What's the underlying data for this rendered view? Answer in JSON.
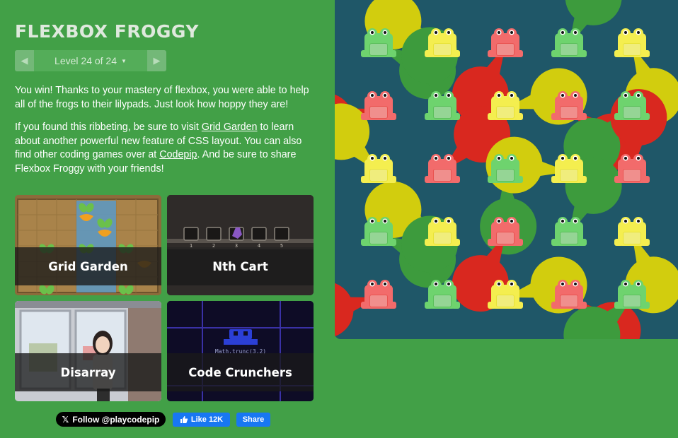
{
  "sidebar": {
    "title": "FLEXBOX FROGGY",
    "level": {
      "prev_icon": "triangle-left-icon",
      "label": "Level 24 of 24",
      "dropdown_icon": "caret-down-icon",
      "next_icon": "triangle-right-icon"
    },
    "intro": {
      "text": "You win! Thanks to your mastery of flexbox, you were able to help all of the frogs to their lilypads. Just look how hoppy they are!"
    },
    "promo": {
      "part1": "If you found this ribbeting, be sure to visit ",
      "link1": "Grid Garden",
      "part2": " to learn about another powerful new feature of CSS layout. You can also find other coding games over at ",
      "link2": "Codepip",
      "part3": ". And be sure to share Flexbox Froggy with your friends!"
    },
    "games": [
      {
        "name": "Grid Garden"
      },
      {
        "name": "Nth Cart",
        "cart_numbers": [
          "1",
          "2",
          "3",
          "4",
          "5"
        ]
      },
      {
        "name": "Disarray"
      },
      {
        "name": "Code Crunchers",
        "snippet": "Math.trunc(3.2)"
      }
    ],
    "social": {
      "follow_icon": "x-logo-icon",
      "follow_label": "Follow @playcodepip",
      "like_icon": "thumbs-up-icon",
      "like_label": "Like 12K",
      "share_label": "Share"
    }
  },
  "board": {
    "colors": {
      "green_pad": "#3d9b3d",
      "green_frog": "#6ed36e",
      "yellow_pad": "#d2cd0e",
      "yellow_frog": "#f4ee4f",
      "red_pad": "#d9281f",
      "red_frog": "#f26b6b",
      "water": "#1f5768"
    },
    "grid": [
      [
        "green",
        "yellow",
        "red",
        "green",
        "yellow"
      ],
      [
        "red",
        "green",
        "yellow",
        "red",
        "green"
      ],
      [
        "yellow",
        "red",
        "green",
        "yellow",
        "red"
      ],
      [
        "green",
        "yellow",
        "red",
        "green",
        "yellow"
      ],
      [
        "red",
        "green",
        "yellow",
        "red",
        "green"
      ]
    ]
  }
}
